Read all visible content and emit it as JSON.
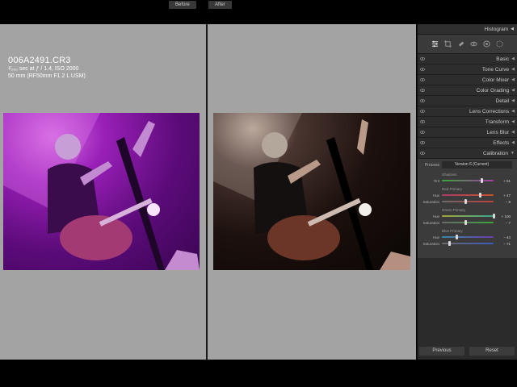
{
  "info": {
    "filename": "006A2491.CR3",
    "exposure_line": "¹⁄₂₅₀ sec at ƒ / 1.4, ISO 2000",
    "lens_line": "50 mm (RF50mm F1.2 L USM)"
  },
  "compare": {
    "before_label": "Before",
    "after_label": "After"
  },
  "panel": {
    "histogram_label": "Histogram",
    "sections": [
      {
        "label": "Basic"
      },
      {
        "label": "Tone Curve"
      },
      {
        "label": "Color Mixer"
      },
      {
        "label": "Color Grading"
      },
      {
        "label": "Detail"
      },
      {
        "label": "Lens Corrections"
      },
      {
        "label": "Transform"
      },
      {
        "label": "Lens Blur"
      },
      {
        "label": "Effects"
      },
      {
        "label": "Calibration"
      }
    ],
    "calibration": {
      "process_label": "Process",
      "process_value": "Version 6 (Current)",
      "shadows_label": "Shadows",
      "shadows_tint": {
        "label": "Tint",
        "value": "+ 51",
        "fraction": 0.76
      },
      "red_primary_label": "Red Primary",
      "red_hue": {
        "label": "Hue",
        "value": "+ 47",
        "fraction": 0.73
      },
      "red_saturation": {
        "label": "Saturation",
        "value": "− 8",
        "fraction": 0.46
      },
      "green_primary_label": "Green Primary",
      "green_hue": {
        "label": "Hue",
        "value": "+ 100",
        "fraction": 1.0
      },
      "green_saturation": {
        "label": "Saturation",
        "value": "− 7",
        "fraction": 0.46
      },
      "blue_primary_label": "Blue Primary",
      "blue_hue": {
        "label": "Hue",
        "value": "− 44",
        "fraction": 0.28
      },
      "blue_saturation": {
        "label": "Saturation",
        "value": "− 71",
        "fraction": 0.14
      }
    },
    "previous_label": "Previous",
    "reset_label": "Reset"
  },
  "colors": {
    "pane_gray": "#a3a3a3",
    "panel_bg": "#2b2b2b",
    "before_tint": "#9a1fb8"
  },
  "icons": [
    "eye-icon",
    "triangle-left-icon",
    "sliders-icon",
    "crop-icon",
    "heal-icon",
    "redeye-icon",
    "mask-icon",
    "presets-icon"
  ]
}
